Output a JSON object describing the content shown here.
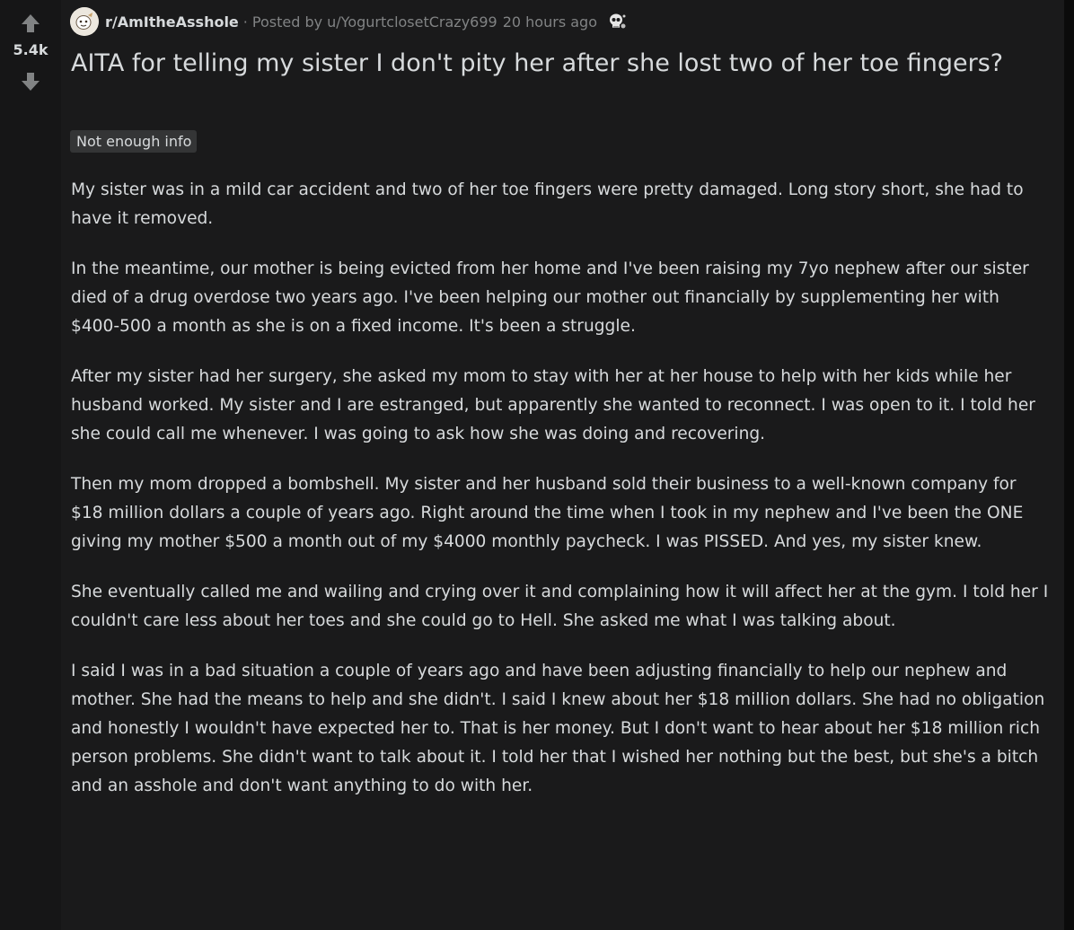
{
  "vote": {
    "score": "5.4k"
  },
  "post": {
    "subreddit": "r/AmItheAsshole",
    "separator": "·",
    "posted_by": "Posted by u/YogurtclosetCrazy699",
    "time": "20 hours ago",
    "award_icon": "skull-award-icon",
    "title": "AITA for telling my sister I don't pity her after she lost two of her toe fingers?",
    "flair": "Not enough info",
    "paragraphs": [
      "My sister was in a mild car accident and two of her toe fingers were pretty damaged. Long story short, she had to have it removed.",
      "In the meantime, our mother is being evicted from her home and I've been raising my 7yo nephew after our sister died of a drug overdose two years ago. I've been helping our mother out financially by supplementing her with $400-500 a month as she is on a fixed income. It's been a struggle.",
      "After my sister had her surgery, she asked my mom to stay with her at her house to help with her kids while her husband worked. My sister and I are estranged, but apparently she wanted to reconnect. I was open to it. I told her she could call me whenever. I was going to ask how she was doing and recovering.",
      "Then my mom dropped a bombshell. My sister and her husband sold their business to a well-known company for $18 million dollars a couple of years ago. Right around the time when I took in my nephew and I've been the ONE giving my mother $500 a month out of my $4000 monthly paycheck. I was PISSED. And yes, my sister knew.",
      "She eventually called me and wailing and crying over it and complaining how it will affect her at the gym. I told her I couldn't care less about her toes and she could go to Hell. She asked me what I was talking about.",
      "I said I was in a bad situation a couple of years ago and have been adjusting financially to help our nephew and mother. She had the means to help and she didn't. I said I knew about her $18 million dollars. She had no obligation and honestly I wouldn't have expected her to. That is her money. But I don't want to hear about her $18 million rich person problems. She didn't want to talk about it. I told her that I wished her nothing but the best, but she's a bitch and an asshole and don't want anything to do with her."
    ]
  },
  "colors": {
    "background": "#1a1a1b",
    "vote_column": "#161617",
    "text": "#d7dadc",
    "muted_text": "#818384",
    "flair_bg": "#343536",
    "arrow": "#818384"
  }
}
